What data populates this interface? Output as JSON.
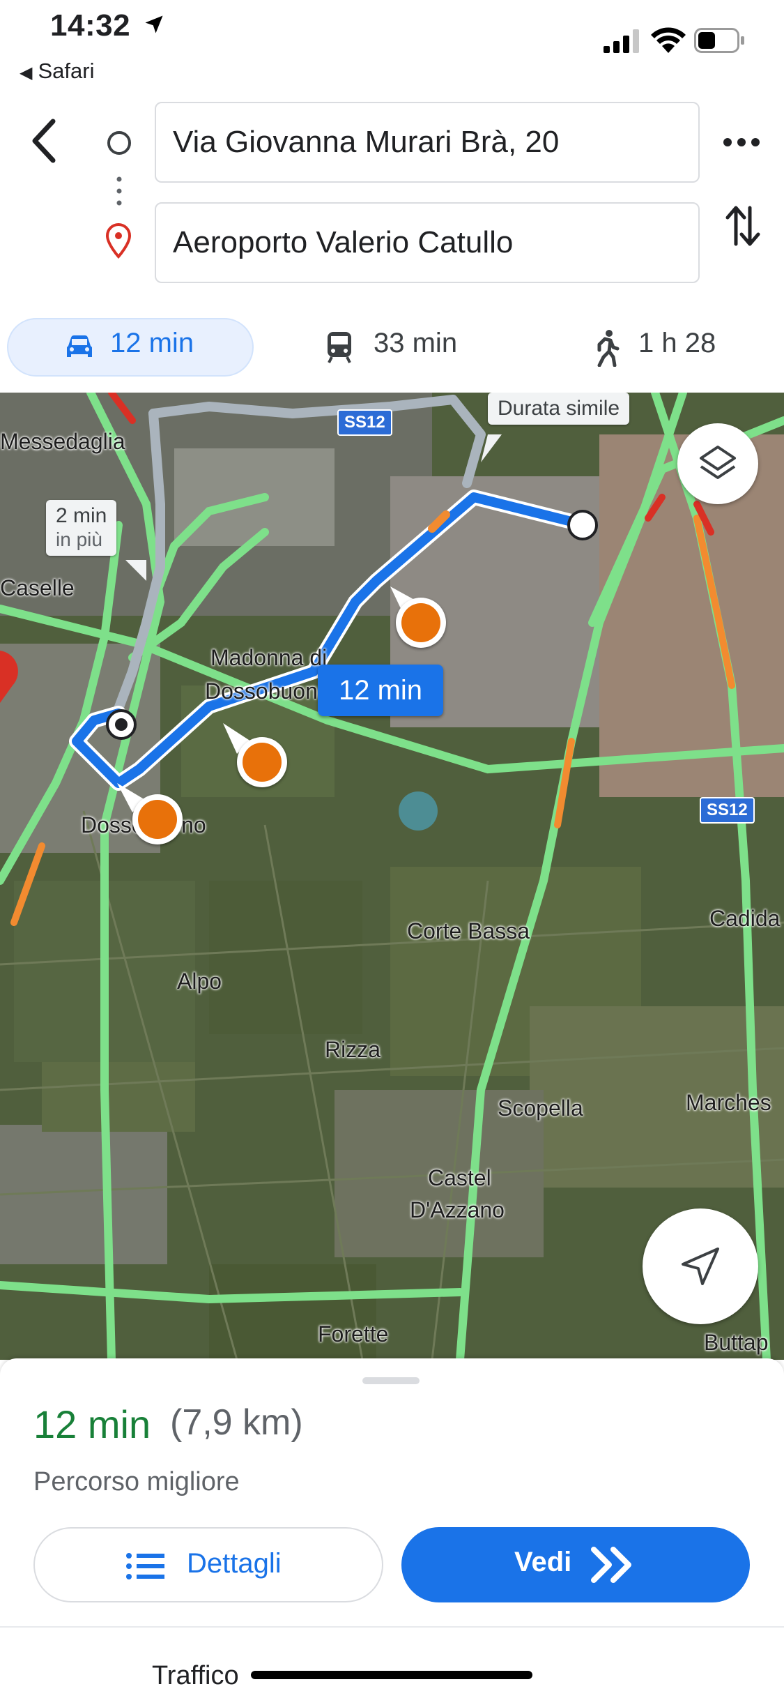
{
  "status_bar": {
    "time": "14:32",
    "back_app": "Safari",
    "icons": [
      "location-arrow-icon",
      "signal-icon",
      "wifi-icon",
      "battery-icon"
    ]
  },
  "directions": {
    "origin": "Via Giovanna Murari Brà, 20",
    "destination": "Aeroporto Valerio Catullo",
    "icons": [
      "back-arrow-icon",
      "origin-circle-icon",
      "destination-pin-icon",
      "more-icon",
      "swap-icon"
    ]
  },
  "modes": [
    {
      "label": "12 min",
      "icon": "car-icon",
      "selected": true
    },
    {
      "label": "33 min",
      "icon": "train-icon",
      "selected": false
    },
    {
      "label": "1 h 28",
      "icon": "walk-icon",
      "selected": false
    }
  ],
  "map": {
    "route_time": "12 min",
    "callouts": {
      "alt_slower_time": "2 min",
      "alt_slower_suffix": "in più",
      "alt_similar": "Durata simile"
    },
    "places": {
      "messedaglia": "Messedaglia",
      "caselle": "Caselle",
      "madonna_1": "Madonna di",
      "madonna_2": "Dossobuono",
      "dossobuono": "Dossobuono",
      "corte_bassa": "Corte Bassa",
      "cadida": "Cadida",
      "alpo": "Alpo",
      "rizza": "Rizza",
      "scopella": "Scopella",
      "marches": "Marches",
      "castel_1": "Castel",
      "castel_2": "D'Azzano",
      "forette": "Forette",
      "buttap": "Buttap"
    },
    "road_shields": [
      "SS12",
      "SS12"
    ],
    "colors": {
      "route": "#1a73e8",
      "alt_route": "#aab4bd",
      "traffic_free": "#7ee08a",
      "traffic_slow": "#f28b30",
      "traffic_heavy": "#d93025",
      "camera": "#e8710a"
    },
    "buttons": [
      "layers-icon",
      "locate-arrow-icon"
    ]
  },
  "sheet": {
    "eta": "12 min",
    "distance": "(7,9 km)",
    "description": "Percorso migliore",
    "details_label": "Dettagli",
    "start_label": "Vedi",
    "next_section": "Traffico"
  },
  "colors": {
    "accent": "#1a73e8",
    "eta_green": "#188038",
    "pin_red": "#d93025"
  }
}
